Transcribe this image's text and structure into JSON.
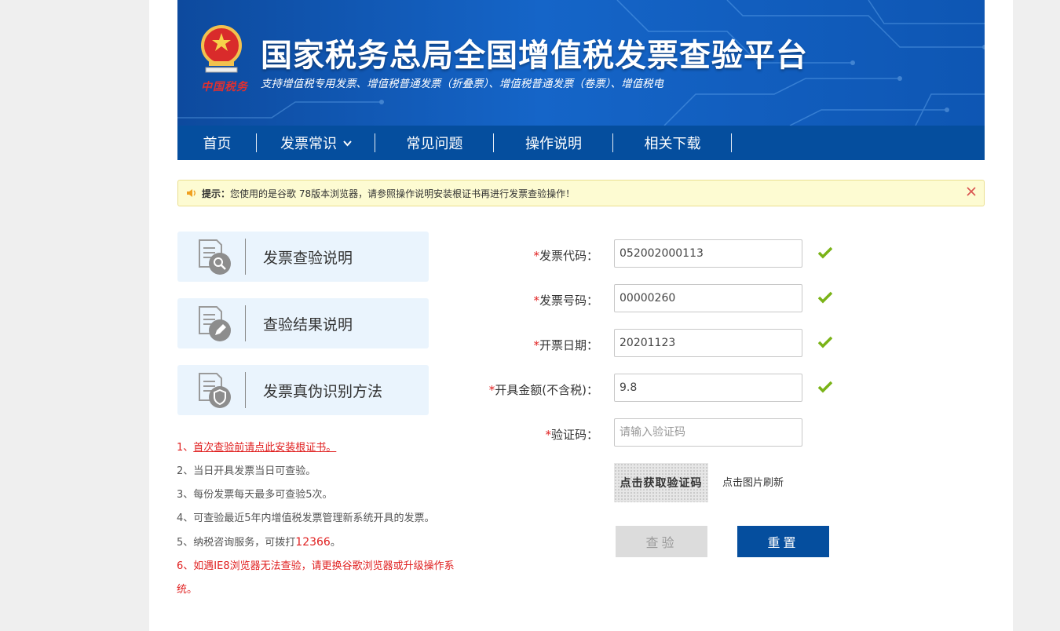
{
  "header": {
    "emblem_text": "中国税务",
    "title": "国家税务总局全国增值税发票查验平台",
    "subtitle": "支持增值税专用发票、增值税普通发票（折叠票）、增值税普通发票（卷票）、增值税电"
  },
  "nav": {
    "items": [
      {
        "label": "首页"
      },
      {
        "label": "发票常识",
        "has_dropdown": true
      },
      {
        "label": "常见问题"
      },
      {
        "label": "操作说明"
      },
      {
        "label": "相关下载"
      }
    ]
  },
  "notice": {
    "label": "提示：",
    "text": "您使用的是谷歌 78版本浏览器，请参照操作说明安装根证书再进行发票查验操作！"
  },
  "cards": [
    {
      "label": "发票查验说明",
      "icon": "doc-search-icon"
    },
    {
      "label": "查验结果说明",
      "icon": "doc-edit-icon"
    },
    {
      "label": "发票真伪识别方法",
      "icon": "doc-shield-icon"
    }
  ],
  "notes": {
    "n1_prefix": "1、",
    "n1_link": "首次查验前请点此安装根证书。",
    "n2": "2、当日开具发票当日可查验。",
    "n3": "3、每份发票每天最多可查验5次。",
    "n4": "4、可查验最近5年内增值税发票管理新系统开具的发票。",
    "n5_prefix": "5、纳税咨询服务，可拨打",
    "n5_phone": "12366",
    "n5_suffix": "。",
    "n6": "6、如遇IE8浏览器无法查验，请更换谷歌浏览器或升级操作系统。"
  },
  "form": {
    "required_mark": "*",
    "code_label": "发票代码：",
    "code_value": "052002000113",
    "number_label": "发票号码：",
    "number_value": "00000260",
    "date_label": "开票日期：",
    "date_value": "20201123",
    "amount_label": "开具金额(不含税)：",
    "amount_value": "9.8",
    "captcha_label": "验证码：",
    "captcha_placeholder": "请输入验证码",
    "captcha_image_text": "点击获取验证码",
    "captcha_hint": "点击图片刷新",
    "query_button": "查验",
    "reset_button": "重置"
  },
  "colors": {
    "nav_bg": "#054e9e",
    "accent_red": "#e02020",
    "check_green": "#7ab317",
    "card_bg": "#eaf4fd"
  }
}
